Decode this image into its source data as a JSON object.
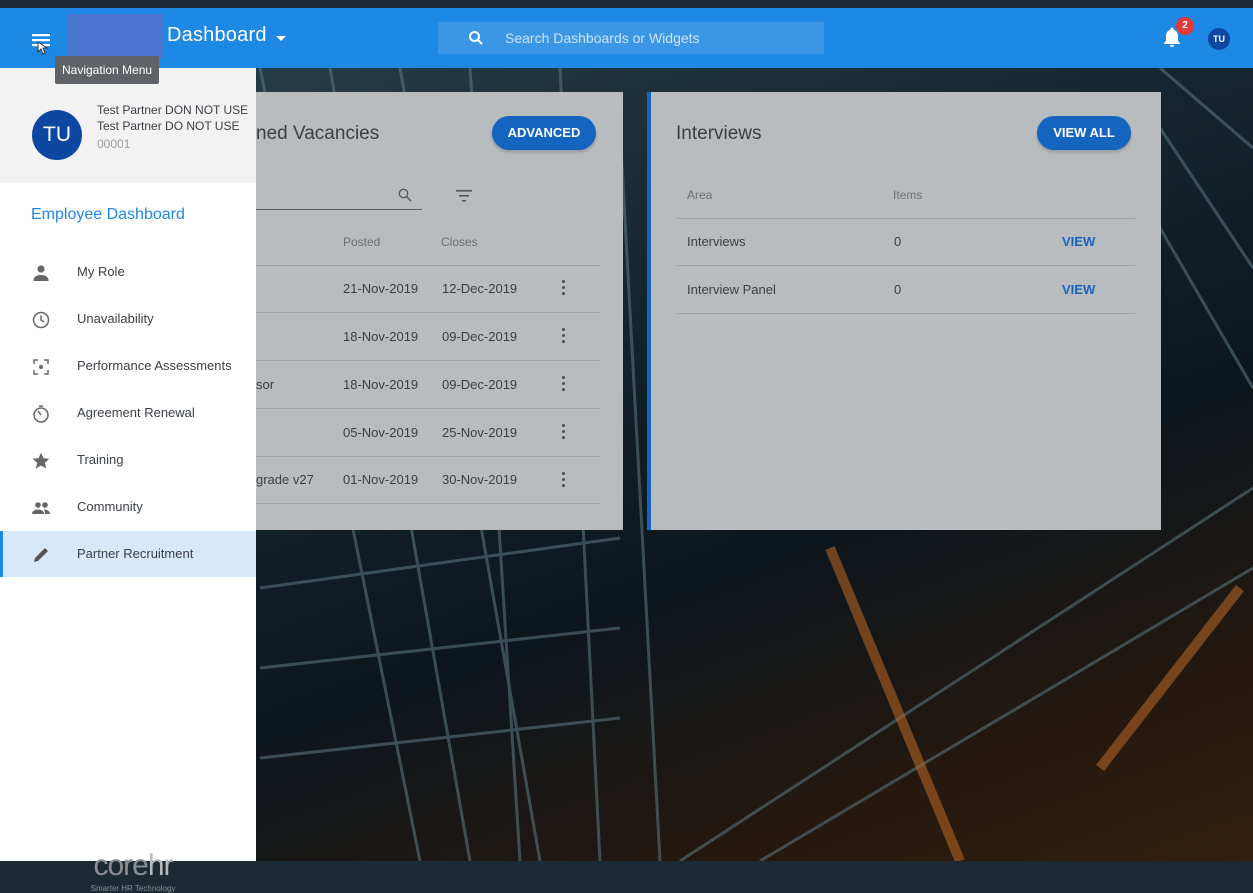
{
  "header": {
    "title": "Dashboard",
    "search_placeholder": "Search Dashboards or Widgets",
    "notification_count": "2",
    "user_initials": "TU",
    "tooltip": "Navigation Menu"
  },
  "drawer": {
    "user": {
      "initials": "TU",
      "name_line1": "Test Partner DON NOT USE",
      "name_line2": "Test Partner DO NOT USE",
      "id": "00001"
    },
    "section_title": "Employee Dashboard",
    "items": [
      {
        "label": "My Role",
        "icon": "person-icon"
      },
      {
        "label": "Unavailability",
        "icon": "clock-icon"
      },
      {
        "label": "Performance Assessments",
        "icon": "focus-icon"
      },
      {
        "label": "Agreement Renewal",
        "icon": "timer-icon"
      },
      {
        "label": "Training",
        "icon": "star-icon"
      },
      {
        "label": "Community",
        "icon": "people-icon"
      },
      {
        "label": "Partner Recruitment",
        "icon": "pencil-icon"
      }
    ],
    "logo": {
      "word_core": "core",
      "word_hr": "hr",
      "tagline": "Smarter HR Technology"
    }
  },
  "vacancies_card": {
    "title_visible": "ned Vacancies",
    "button": "ADVANCED",
    "columns": [
      "Posted",
      "Closes"
    ],
    "rows": [
      {
        "title_fragment": "",
        "posted": "21-Nov-2019",
        "closes": "12-Dec-2019"
      },
      {
        "title_fragment": "",
        "posted": "18-Nov-2019",
        "closes": "09-Dec-2019"
      },
      {
        "title_fragment": "sor",
        "posted": "18-Nov-2019",
        "closes": "09-Dec-2019"
      },
      {
        "title_fragment": "",
        "posted": "05-Nov-2019",
        "closes": "25-Nov-2019"
      },
      {
        "title_fragment": "grade v27",
        "posted": "01-Nov-2019",
        "closes": "30-Nov-2019"
      }
    ]
  },
  "interviews_card": {
    "title": "Interviews",
    "button": "VIEW ALL",
    "columns": [
      "Area",
      "Items"
    ],
    "rows": [
      {
        "area": "Interviews",
        "items": "0",
        "action": "VIEW"
      },
      {
        "area": "Interview Panel",
        "items": "0",
        "action": "VIEW"
      }
    ]
  },
  "colors": {
    "primary": "#1e88e5",
    "button": "#1565c0",
    "badge": "#e53935"
  }
}
